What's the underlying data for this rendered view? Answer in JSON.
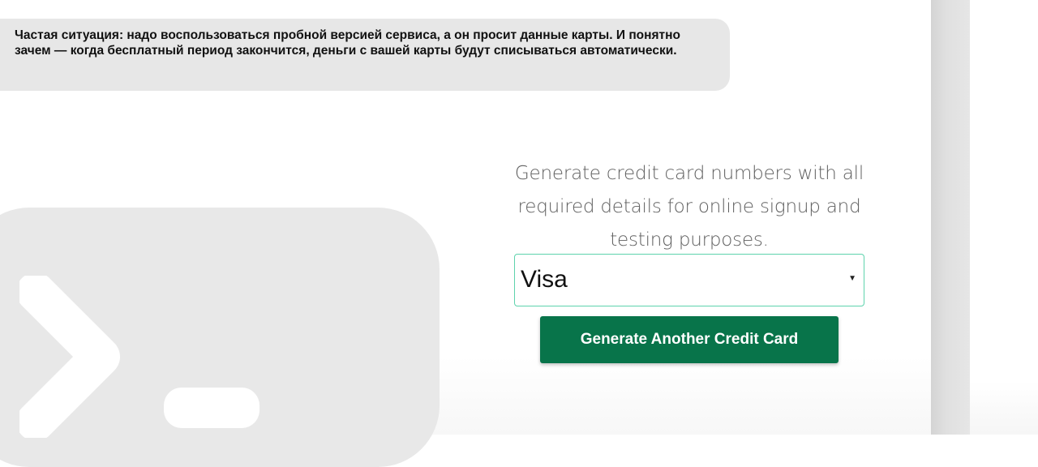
{
  "message": {
    "text": "Частая ситуация: надо воспользоваться пробной версией сервиса, а он просит данные карты. И понятно зачем — когда бесплатный период закончится, деньги с вашей карты будут списываться автоматически."
  },
  "generator": {
    "tagline": "Generate credit card numbers with all required details for online signup and testing purposes.",
    "card_type": {
      "selected": "Visa",
      "caret_icon": "triangle-down-icon"
    },
    "button_label": "Generate Another Credit Card"
  },
  "logo": {
    "icon": "terminal-prompt-icon"
  },
  "colors": {
    "button_bg": "#08744a",
    "select_border": "#5ed3ad",
    "bubble_bg": "#e7e7e7",
    "logo_bg": "#e8e8e8"
  }
}
